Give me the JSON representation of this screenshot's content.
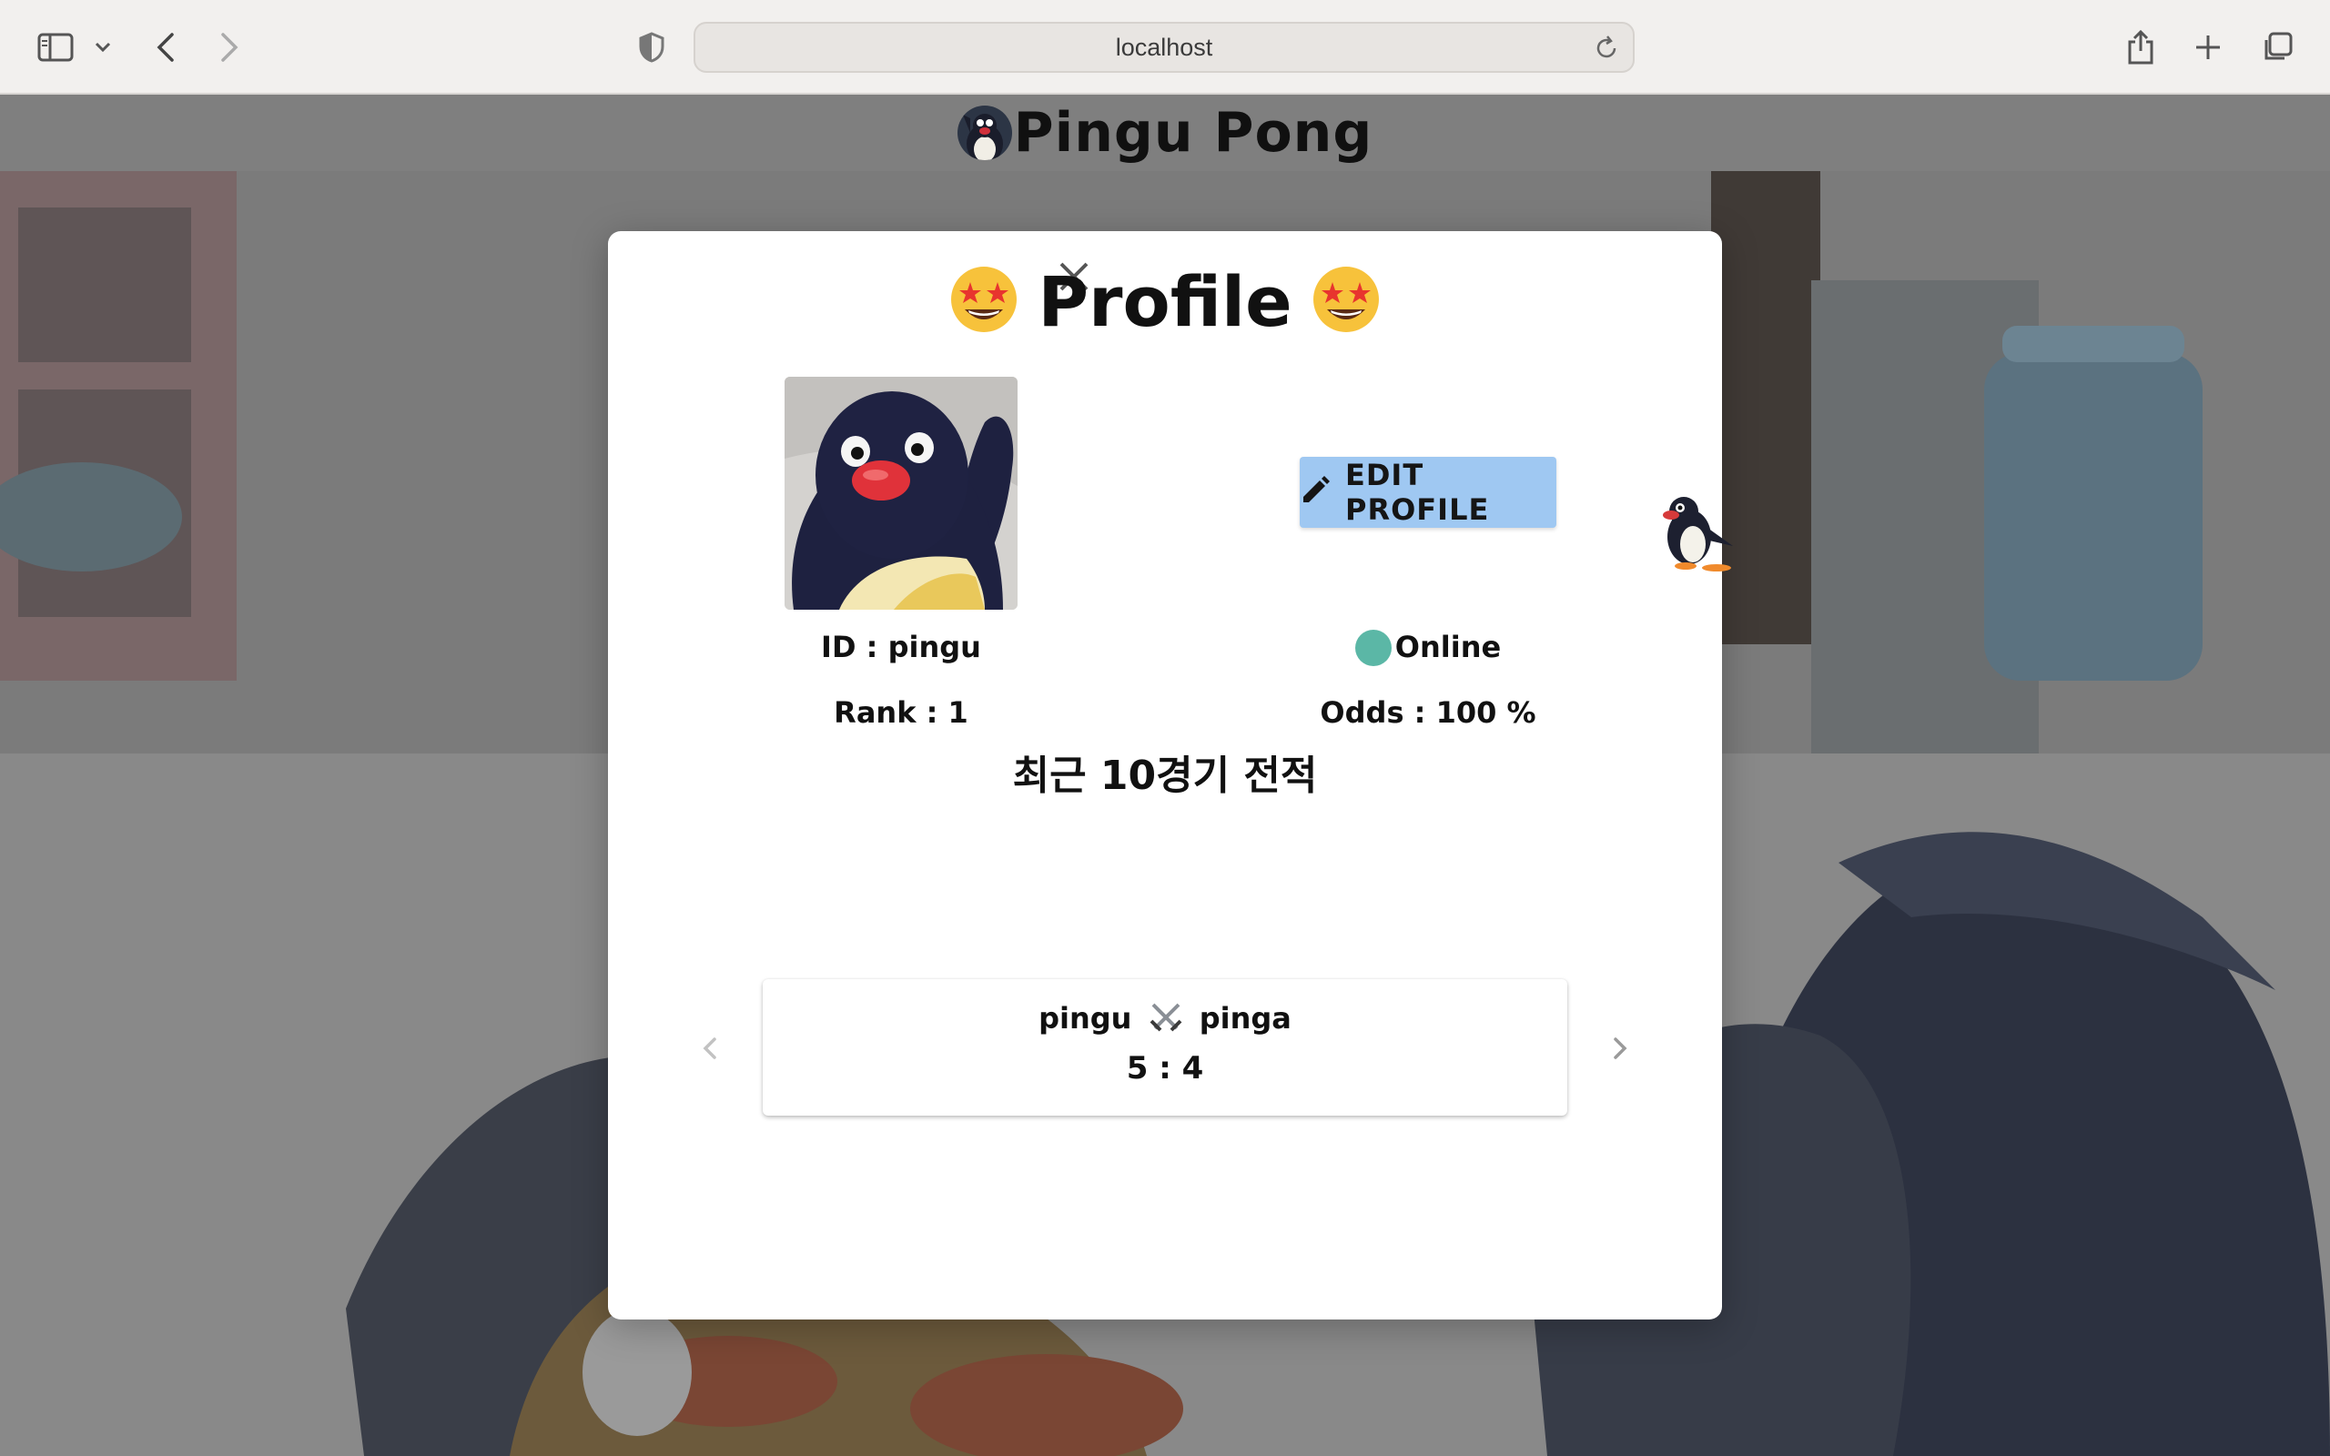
{
  "browser": {
    "url": "localhost"
  },
  "app": {
    "title": "Pingu Pong"
  },
  "modal": {
    "title": "Profile",
    "edit_label": "EDIT PROFILE",
    "id_text": "ID : pingu",
    "rank_text": "Rank : 1",
    "status_text": "Online",
    "odds_text": "Odds : 100 %",
    "history_title": "최근 10경기 전적",
    "match": {
      "players_left": "pingu",
      "players_right": "pinga",
      "score": "5 : 4"
    }
  },
  "colors": {
    "status_online": "#5bb7a6",
    "edit_button": "#9fc8f2",
    "overlay": "#7f7f7f"
  },
  "icons": [
    "sidebar-icon",
    "chevron-down-icon",
    "back-icon",
    "forward-icon",
    "shield-icon",
    "reload-icon",
    "share-icon",
    "plus-icon",
    "tabs-icon",
    "close-icon",
    "pencil-icon",
    "crossed-swords-icon",
    "chevron-left-icon",
    "chevron-right-icon"
  ]
}
